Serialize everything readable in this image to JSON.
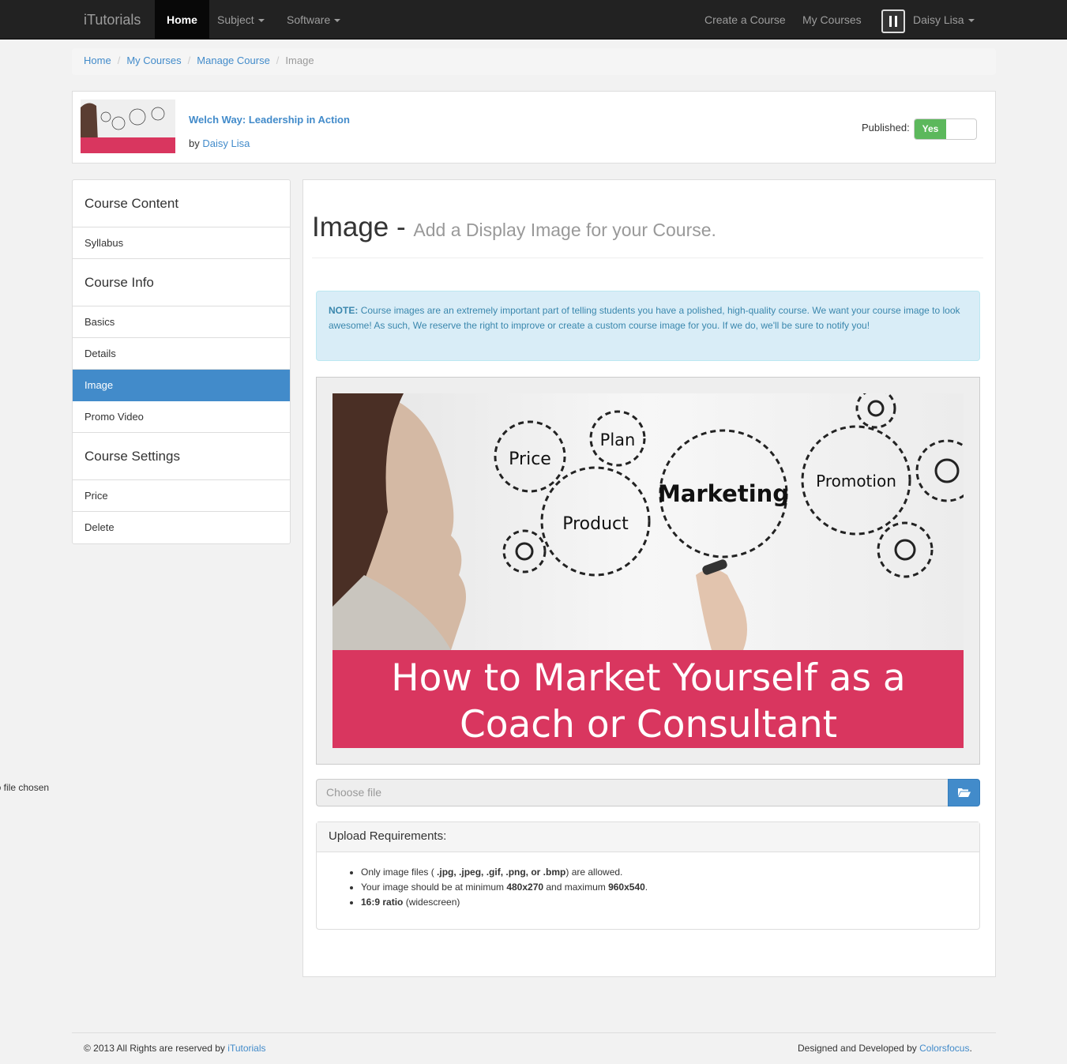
{
  "navbar": {
    "brand": "iTutorials",
    "items": [
      {
        "label": "Home",
        "active": true
      },
      {
        "label": "Subject",
        "dropdown": true
      },
      {
        "label": "Software",
        "dropdown": true
      }
    ],
    "right_items": [
      {
        "label": "Create a Course"
      },
      {
        "label": "My Courses"
      }
    ],
    "user": {
      "name": "Daisy Lisa",
      "icon": "user-avatar-icon"
    }
  },
  "breadcrumb": [
    "Home",
    "My Courses",
    "Manage Course",
    "Image"
  ],
  "course": {
    "title": "Welch Way: Leadership in Action",
    "by_prefix": "by",
    "author": "Daisy Lisa",
    "published_label": "Published:",
    "published_value": "Yes",
    "thumb_caption": "How to Market Yourself as a Coach or Consultant"
  },
  "sidebar": {
    "sections": [
      {
        "heading": "Course Content",
        "items": [
          "Syllabus"
        ]
      },
      {
        "heading": "Course Info",
        "items": [
          "Basics",
          "Details",
          "Image",
          "Promo Video"
        ]
      },
      {
        "heading": "Course Settings",
        "items": [
          "Price",
          "Delete"
        ]
      }
    ],
    "active": "Image"
  },
  "main": {
    "title": "Image",
    "dash": "-",
    "subtitle": "Add a Display Image for your Course.",
    "note_label": "NOTE:",
    "note_text": "Course images are an extremely important part of telling students you have a polished, high-quality course. We want your course image to look awesome! As such, We reserve the right to improve or create a custom course image for you. If we do, we'll be sure to notify you!",
    "image": {
      "gears": [
        "Price",
        "Plan",
        "Marketing",
        "Product",
        "Promotion"
      ],
      "banner_line1": "How to Market Yourself as a",
      "banner_line2": "Coach or Consultant",
      "banner_color": "#d9365f"
    },
    "file_placeholder": "Choose file",
    "file_icon": "folder-open-icon",
    "no_file_text": "No file chosen",
    "requirements": {
      "heading": "Upload Requirements:",
      "items": [
        {
          "a": "Only image files ( ",
          "b": ".jpg, .jpeg, .gif, .png, or .bmp",
          "c": ") are allowed."
        },
        {
          "a": "Your image should be at minimum ",
          "b": "480x270",
          "c": " and maximum ",
          "d": "960x540",
          "e": "."
        },
        {
          "b": "16:9 ratio",
          "c": " (widescreen)"
        }
      ]
    }
  },
  "footer": {
    "left_text": "© 2013 All Rights are reserved by",
    "left_link": "iTutorials",
    "right_text": "Designed and Developed by",
    "right_link": "Colorsfocus",
    "right_end": "."
  },
  "colors": {
    "primary": "#428bca",
    "success": "#5cb85c",
    "navbar": "#222222",
    "info_bg": "#d9edf7"
  }
}
